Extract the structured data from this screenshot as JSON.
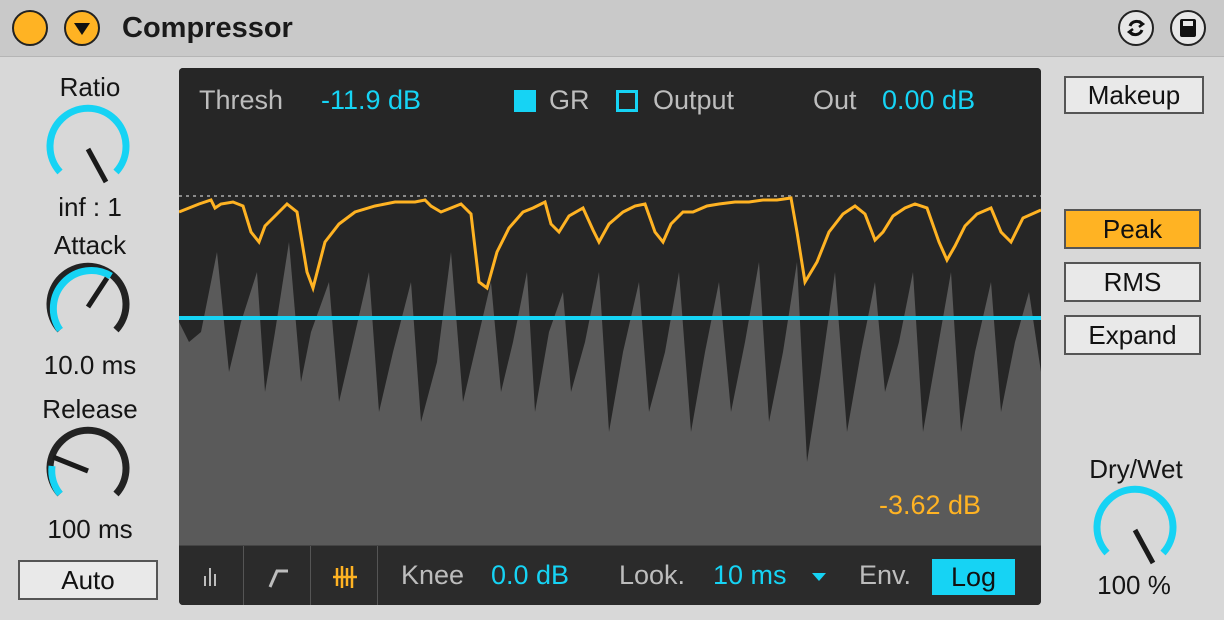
{
  "device": {
    "title": "Compressor",
    "icons": {
      "power": "power-icon",
      "fold": "fold-arrow-icon",
      "hot_swap": "hot-swap-icon",
      "save": "save-icon"
    }
  },
  "left": {
    "ratio": {
      "label": "Ratio",
      "value": "inf : 1"
    },
    "attack": {
      "label": "Attack",
      "value": "10.0 ms"
    },
    "release": {
      "label": "Release",
      "value": "100 ms"
    },
    "auto_button": "Auto"
  },
  "display": {
    "thresh_label": "Thresh",
    "thresh_value": "-11.9 dB",
    "gr_label": "GR",
    "output_label": "Output",
    "out_label": "Out",
    "out_value": "0.00 dB",
    "gain_reduction_readout": "-3.62 dB",
    "knee_label": "Knee",
    "knee_value": "0.0 dB",
    "lookahead_label": "Look.",
    "lookahead_value": "10 ms",
    "env_label": "Env.",
    "env_value": "Log",
    "view_tabs": [
      "collapsed-view-icon",
      "transfer-curve-icon",
      "activity-view-icon"
    ]
  },
  "right": {
    "makeup_button": "Makeup",
    "mode_buttons": [
      "Peak",
      "RMS",
      "Expand"
    ],
    "active_mode": "Peak",
    "drywet": {
      "label": "Dry/Wet",
      "value": "100 %"
    }
  },
  "colors": {
    "accent_cyan": "#16d3f4",
    "accent_orange": "#ffb323",
    "panel_bg": "#262626",
    "device_bg": "#d8d8d8"
  }
}
